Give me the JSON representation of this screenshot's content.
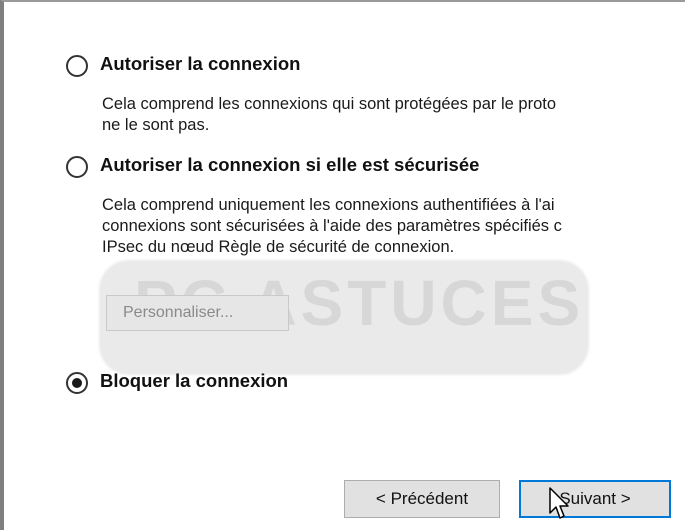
{
  "options": [
    {
      "label": "Autoriser la connexion",
      "selected": false,
      "description": [
        "Cela comprend les connexions qui sont protégées par le proto",
        "ne le sont pas."
      ]
    },
    {
      "label": "Autoriser la connexion si elle est sécurisée",
      "selected": false,
      "description": [
        "Cela comprend uniquement les connexions authentifiées à l'ai",
        "connexions sont sécurisées à l'aide des paramètres spécifiés c",
        "IPsec du nœud Règle de sécurité de connexion."
      ],
      "button": "Personnaliser..."
    },
    {
      "label": "Bloquer la connexion",
      "selected": true
    }
  ],
  "watermark": "PC ASTUCES",
  "footer": {
    "back": "< Précédent",
    "next": "Suivant >"
  },
  "colors": {
    "accent": "#0078d7",
    "button_bg": "#e1e1e1",
    "disabled_text": "#8a8a8a"
  },
  "icons": {
    "cursor": "mouse-pointer-icon"
  }
}
